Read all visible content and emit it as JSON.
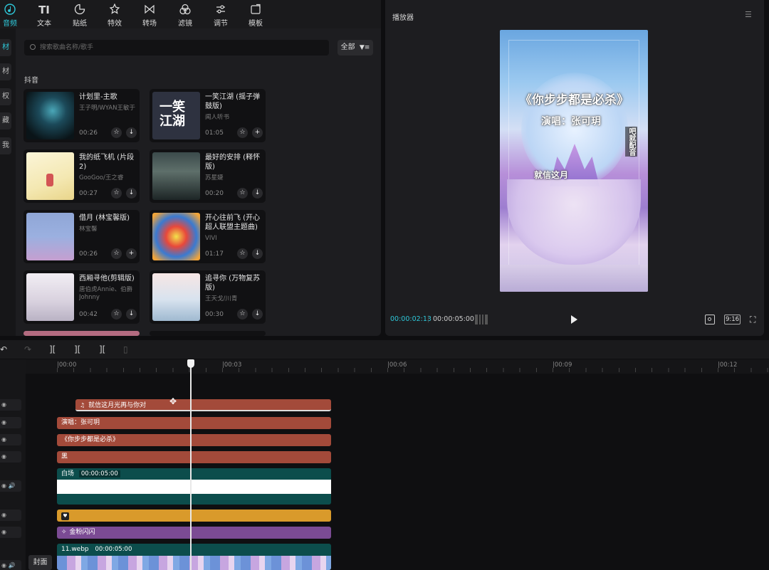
{
  "toolbar": [
    {
      "label": "音频",
      "icon": "music-note-icon",
      "active": true
    },
    {
      "label": "文本",
      "icon": "text-icon",
      "active": false
    },
    {
      "label": "贴纸",
      "icon": "sticker-icon",
      "active": false
    },
    {
      "label": "特效",
      "icon": "sparkle-icon",
      "active": false
    },
    {
      "label": "转场",
      "icon": "transition-icon",
      "active": false
    },
    {
      "label": "滤镜",
      "icon": "filter-icon",
      "active": false
    },
    {
      "label": "调节",
      "icon": "adjust-icon",
      "active": false
    },
    {
      "label": "模板",
      "icon": "template-icon",
      "active": false
    }
  ],
  "side_tabs": [
    "材",
    "材",
    "权",
    "藏",
    "我"
  ],
  "search": {
    "placeholder": "搜索歌曲名称/歌手"
  },
  "filter": {
    "label": "全部"
  },
  "section_label": "抖音",
  "songs": [
    {
      "title": "计划里-主歌",
      "artist": "王子明/WYAN王敏于",
      "duration": "00:26"
    },
    {
      "title": "一笑江湖 (摇子弹鼓版)",
      "artist": "闻人听书",
      "duration": "01:05"
    },
    {
      "title": "我的纸飞机 (片段2)",
      "artist": "GooGoo/王之睿",
      "duration": "00:27"
    },
    {
      "title": "最好的安排 (释怀版)",
      "artist": "苏星婕",
      "duration": "00:20"
    },
    {
      "title": "借月 (林宝馨版)",
      "artist": "林宝馨",
      "duration": "00:26"
    },
    {
      "title": "开心往前飞 (开心超人联盟主题曲)",
      "artist": "VIVI",
      "duration": "01:17"
    },
    {
      "title": "西厢寻他(剪辑版)",
      "artist": "唐伯虎Annie、伯爵Johnny",
      "duration": "00:42"
    },
    {
      "title": "追寻你 (万物复苏版)",
      "artist": "王天戈/川青",
      "duration": "00:30"
    }
  ],
  "player": {
    "title": "播放器",
    "current_time": "00:00:02:13",
    "total_time": "00:00:05:00",
    "ratio": "9:16",
    "overlay_title": "《你步步都是必杀》",
    "overlay_singer": "演唱：张可玥",
    "overlay_lyric": "就信这月",
    "overlay_side": "吧就配音"
  },
  "timeline": {
    "ticks": [
      "|00:00",
      "|00:03",
      "|00:06",
      "|00:09",
      "|00:12"
    ],
    "clips": {
      "lyric": "就信这月光再与你对",
      "singer": "演唱：张可玥",
      "title": "《你步步都是必杀》",
      "black": "黑",
      "bg_label": "白场",
      "bg_dur": "00:00:05:00",
      "effect": "金粉闪闪",
      "video_label": "11.webp",
      "video_dur": "00:00:05:00"
    },
    "cover": "封面",
    "playhead_seconds": 2.43
  }
}
